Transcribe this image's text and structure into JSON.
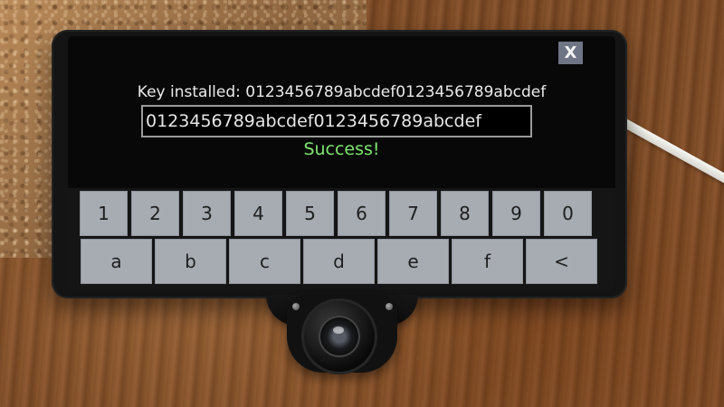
{
  "dialog": {
    "close_label": "X",
    "key_installed_label": "Key installed:",
    "installed_key_value": "0123456789abcdef0123456789abcdef",
    "input_value": "0123456789abcdef0123456789abcdef",
    "status_text": "Success!"
  },
  "keyboard": {
    "row1": [
      "1",
      "2",
      "3",
      "4",
      "5",
      "6",
      "7",
      "8",
      "9",
      "0"
    ],
    "row2": [
      "a",
      "b",
      "c",
      "d",
      "e",
      "f",
      "<"
    ]
  },
  "colors": {
    "screen_background": "#080808",
    "success_text": "#7ee66f",
    "key_background": "#a7abb2"
  }
}
